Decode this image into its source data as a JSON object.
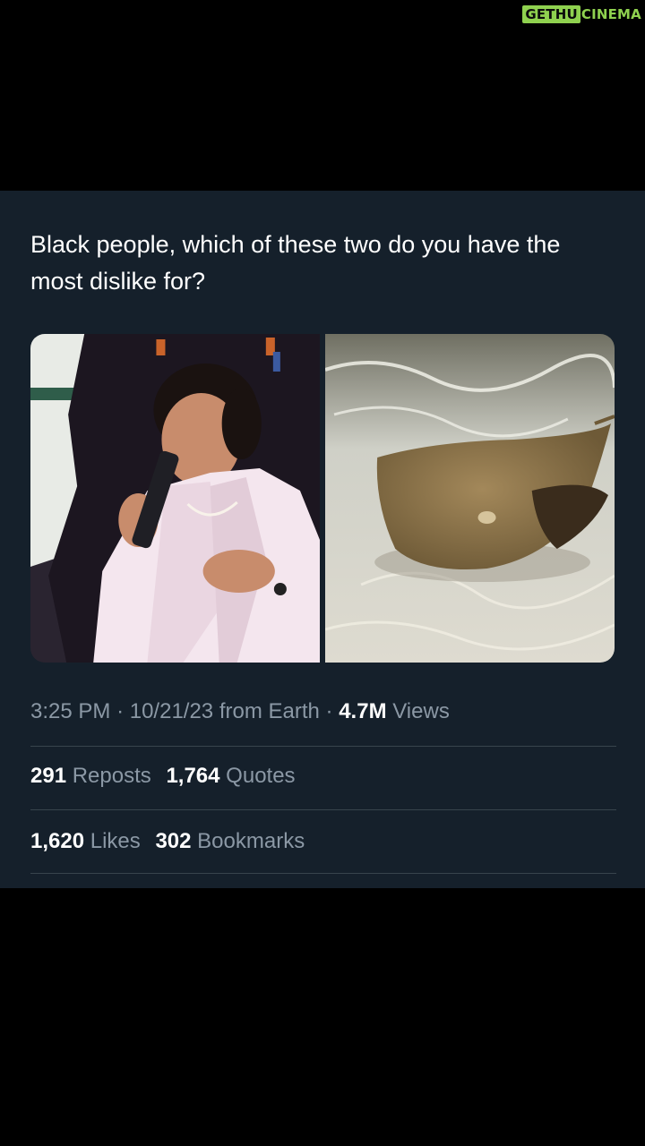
{
  "watermark": {
    "left": "GETHU",
    "right": "CINEMA"
  },
  "tweet": {
    "text": "Black people, which of these two do you have the most dislike for?",
    "images": [
      {
        "icon": "photo-woman-singing"
      },
      {
        "icon": "photo-stingray"
      }
    ],
    "time": "3:25 PM",
    "separator": "·",
    "date": "10/21/23",
    "source": "from Earth",
    "views_count": "4.7M",
    "views_label": "Views",
    "reposts_count": "291",
    "reposts_label": "Reposts",
    "quotes_count": "1,764",
    "quotes_label": "Quotes",
    "likes_count": "1,620",
    "likes_label": "Likes",
    "bookmarks_count": "302",
    "bookmarks_label": "Bookmarks"
  },
  "colors": {
    "background": "#000000",
    "card": "#15202b",
    "text": "#ffffff",
    "muted": "#8b98a5",
    "divider": "#38444d",
    "watermark": "#8fd14f"
  }
}
